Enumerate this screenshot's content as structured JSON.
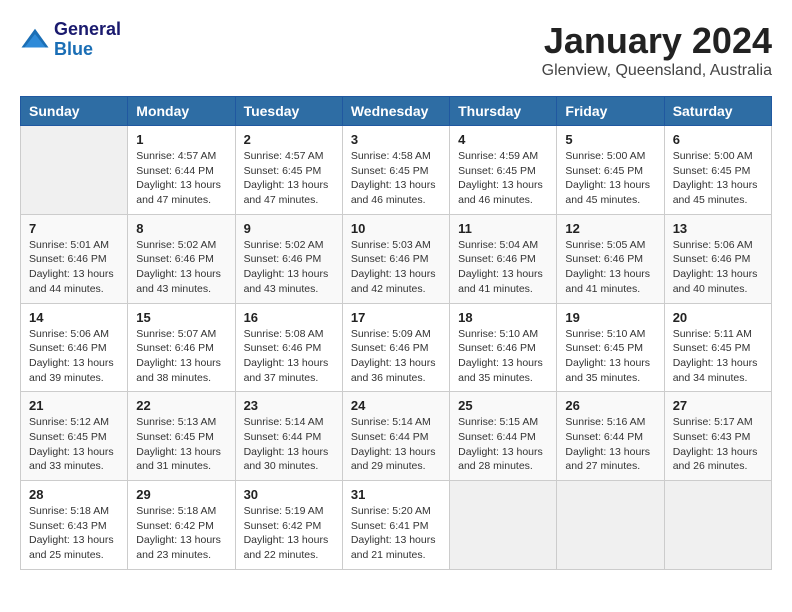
{
  "header": {
    "logo_general": "General",
    "logo_blue": "Blue",
    "title": "January 2024",
    "subtitle": "Glenview, Queensland, Australia"
  },
  "calendar": {
    "days_of_week": [
      "Sunday",
      "Monday",
      "Tuesday",
      "Wednesday",
      "Thursday",
      "Friday",
      "Saturday"
    ],
    "weeks": [
      [
        {
          "day": "",
          "info": ""
        },
        {
          "day": "1",
          "info": "Sunrise: 4:57 AM\nSunset: 6:44 PM\nDaylight: 13 hours\nand 47 minutes."
        },
        {
          "day": "2",
          "info": "Sunrise: 4:57 AM\nSunset: 6:45 PM\nDaylight: 13 hours\nand 47 minutes."
        },
        {
          "day": "3",
          "info": "Sunrise: 4:58 AM\nSunset: 6:45 PM\nDaylight: 13 hours\nand 46 minutes."
        },
        {
          "day": "4",
          "info": "Sunrise: 4:59 AM\nSunset: 6:45 PM\nDaylight: 13 hours\nand 46 minutes."
        },
        {
          "day": "5",
          "info": "Sunrise: 5:00 AM\nSunset: 6:45 PM\nDaylight: 13 hours\nand 45 minutes."
        },
        {
          "day": "6",
          "info": "Sunrise: 5:00 AM\nSunset: 6:45 PM\nDaylight: 13 hours\nand 45 minutes."
        }
      ],
      [
        {
          "day": "7",
          "info": "Sunrise: 5:01 AM\nSunset: 6:46 PM\nDaylight: 13 hours\nand 44 minutes."
        },
        {
          "day": "8",
          "info": "Sunrise: 5:02 AM\nSunset: 6:46 PM\nDaylight: 13 hours\nand 43 minutes."
        },
        {
          "day": "9",
          "info": "Sunrise: 5:02 AM\nSunset: 6:46 PM\nDaylight: 13 hours\nand 43 minutes."
        },
        {
          "day": "10",
          "info": "Sunrise: 5:03 AM\nSunset: 6:46 PM\nDaylight: 13 hours\nand 42 minutes."
        },
        {
          "day": "11",
          "info": "Sunrise: 5:04 AM\nSunset: 6:46 PM\nDaylight: 13 hours\nand 41 minutes."
        },
        {
          "day": "12",
          "info": "Sunrise: 5:05 AM\nSunset: 6:46 PM\nDaylight: 13 hours\nand 41 minutes."
        },
        {
          "day": "13",
          "info": "Sunrise: 5:06 AM\nSunset: 6:46 PM\nDaylight: 13 hours\nand 40 minutes."
        }
      ],
      [
        {
          "day": "14",
          "info": "Sunrise: 5:06 AM\nSunset: 6:46 PM\nDaylight: 13 hours\nand 39 minutes."
        },
        {
          "day": "15",
          "info": "Sunrise: 5:07 AM\nSunset: 6:46 PM\nDaylight: 13 hours\nand 38 minutes."
        },
        {
          "day": "16",
          "info": "Sunrise: 5:08 AM\nSunset: 6:46 PM\nDaylight: 13 hours\nand 37 minutes."
        },
        {
          "day": "17",
          "info": "Sunrise: 5:09 AM\nSunset: 6:46 PM\nDaylight: 13 hours\nand 36 minutes."
        },
        {
          "day": "18",
          "info": "Sunrise: 5:10 AM\nSunset: 6:46 PM\nDaylight: 13 hours\nand 35 minutes."
        },
        {
          "day": "19",
          "info": "Sunrise: 5:10 AM\nSunset: 6:45 PM\nDaylight: 13 hours\nand 35 minutes."
        },
        {
          "day": "20",
          "info": "Sunrise: 5:11 AM\nSunset: 6:45 PM\nDaylight: 13 hours\nand 34 minutes."
        }
      ],
      [
        {
          "day": "21",
          "info": "Sunrise: 5:12 AM\nSunset: 6:45 PM\nDaylight: 13 hours\nand 33 minutes."
        },
        {
          "day": "22",
          "info": "Sunrise: 5:13 AM\nSunset: 6:45 PM\nDaylight: 13 hours\nand 31 minutes."
        },
        {
          "day": "23",
          "info": "Sunrise: 5:14 AM\nSunset: 6:44 PM\nDaylight: 13 hours\nand 30 minutes."
        },
        {
          "day": "24",
          "info": "Sunrise: 5:14 AM\nSunset: 6:44 PM\nDaylight: 13 hours\nand 29 minutes."
        },
        {
          "day": "25",
          "info": "Sunrise: 5:15 AM\nSunset: 6:44 PM\nDaylight: 13 hours\nand 28 minutes."
        },
        {
          "day": "26",
          "info": "Sunrise: 5:16 AM\nSunset: 6:44 PM\nDaylight: 13 hours\nand 27 minutes."
        },
        {
          "day": "27",
          "info": "Sunrise: 5:17 AM\nSunset: 6:43 PM\nDaylight: 13 hours\nand 26 minutes."
        }
      ],
      [
        {
          "day": "28",
          "info": "Sunrise: 5:18 AM\nSunset: 6:43 PM\nDaylight: 13 hours\nand 25 minutes."
        },
        {
          "day": "29",
          "info": "Sunrise: 5:18 AM\nSunset: 6:42 PM\nDaylight: 13 hours\nand 23 minutes."
        },
        {
          "day": "30",
          "info": "Sunrise: 5:19 AM\nSunset: 6:42 PM\nDaylight: 13 hours\nand 22 minutes."
        },
        {
          "day": "31",
          "info": "Sunrise: 5:20 AM\nSunset: 6:41 PM\nDaylight: 13 hours\nand 21 minutes."
        },
        {
          "day": "",
          "info": ""
        },
        {
          "day": "",
          "info": ""
        },
        {
          "day": "",
          "info": ""
        }
      ]
    ]
  }
}
